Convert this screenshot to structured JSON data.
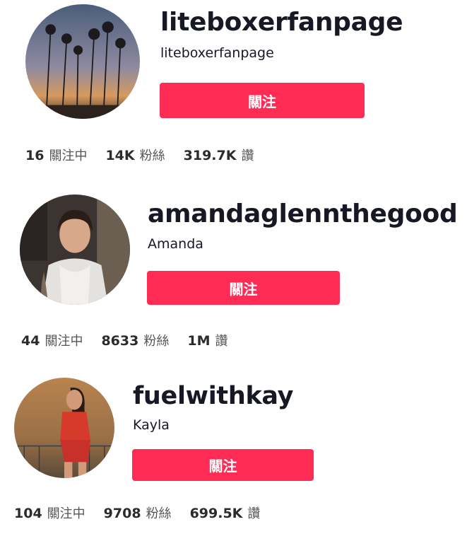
{
  "profiles": [
    {
      "username": "liteboxerfanpage",
      "nickname": "liteboxerfanpage",
      "follow_label": "關注",
      "following_count": "16",
      "following_label": "關注中",
      "followers_count": "14K",
      "followers_label": "粉絲",
      "likes_count": "319.7K",
      "likes_label": "讚"
    },
    {
      "username": "amandaglennthegood",
      "nickname": "Amanda",
      "follow_label": "關注",
      "following_count": "44",
      "following_label": "關注中",
      "followers_count": "8633",
      "followers_label": "粉絲",
      "likes_count": "1M",
      "likes_label": "讚"
    },
    {
      "username": "fuelwithkay",
      "nickname": "Kayla",
      "follow_label": "關注",
      "following_count": "104",
      "following_label": "關注中",
      "followers_count": "9708",
      "followers_label": "粉絲",
      "likes_count": "699.5K",
      "likes_label": "讚"
    }
  ],
  "colors": {
    "accent": "#fe2c55",
    "text": "#161823",
    "muted": "#555555"
  }
}
